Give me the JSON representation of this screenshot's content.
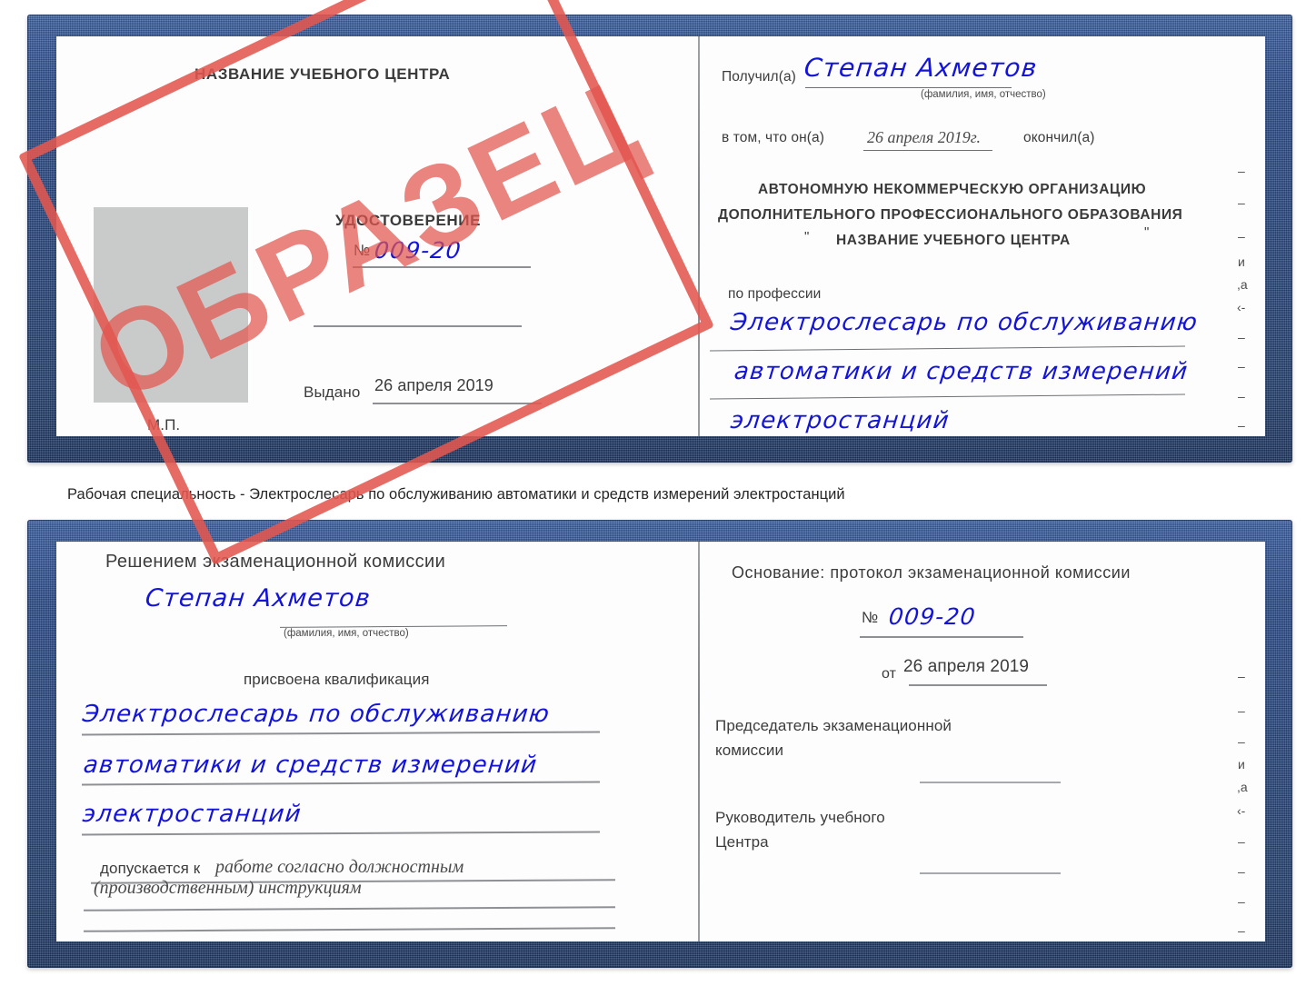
{
  "document": {
    "type": "certificate-scan",
    "stamp_label": "ОБРАЗЕЦ",
    "colors": {
      "cover_blue": "#2b4c8c",
      "stamp_red": "#e2564f",
      "handwriting_blue": "#1414d8",
      "photo_placeholder_gray": "#c9cbcb",
      "rule_gray": "#8e9094",
      "text_dark": "#3a3a3a"
    }
  },
  "caption": {
    "text": "Рабочая специальность - Электрослесарь по обслуживанию автоматики и средств измерений электростанций"
  },
  "certificate_top": {
    "left_page": {
      "center_name": "НАЗВАНИЕ УЧЕБНОГО ЦЕНТРА",
      "doc_title": "УДОСТОВЕРЕНИЕ",
      "number_label": "№",
      "number_value": "009-20",
      "issued_label": "Выдано",
      "issued_value": "26 апреля 2019",
      "seal_label": "М.П.",
      "photo_placeholder": ""
    },
    "right_page": {
      "received_label": "Получил(а)",
      "received_value": "Степан Ахметов",
      "fio_hint": "(фамилия, имя, отчество)",
      "in_that_label": "в том, что он(а)",
      "completion_date": "26 апреля 2019г.",
      "finished_label": "окончил(а)",
      "org_line1": "АВТОНОМНУЮ НЕКОММЕРЧЕСКУЮ ОРГАНИЗАЦИЮ",
      "org_line2": "ДОПОЛНИТЕЛЬНОГО ПРОФЕССИОНАЛЬНОГО ОБРАЗОВАНИЯ",
      "org_quote_open": "\"",
      "org_line3": "НАЗВАНИЕ УЧЕБНОГО ЦЕНТРА",
      "org_quote_close": "\"",
      "profession_label": "по профессии",
      "profession_line1": "Электрослесарь по обслуживанию",
      "profession_line2": "автоматики и средств измерений",
      "profession_line3": "электростанций",
      "edge_marks": [
        "–",
        "–",
        "–",
        "и",
        "а",
        "‹-",
        "–",
        "–",
        "–",
        "–"
      ]
    }
  },
  "certificate_bottom": {
    "left_page": {
      "heading": "Решением экзаменационной комиссии",
      "name_value": "Степан Ахметов",
      "fio_hint": "(фамилия, имя, отчество)",
      "qualification_label": "присвоена квалификация",
      "qualification_line1": "Электрослесарь по обслуживанию",
      "qualification_line2": "автоматики и средств измерений",
      "qualification_line3": "электростанций",
      "allowed_label": "допускается к",
      "allowed_value_line1": "работе согласно должностным",
      "allowed_value_line2": "(производственным) инструкциям"
    },
    "right_page": {
      "basis_label": "Основание: протокол экзаменационной комиссии",
      "number_label": "№",
      "number_value": "009-20",
      "date_label": "от",
      "date_value": "26 апреля 2019",
      "chairman_line1": "Председатель экзаменационной",
      "chairman_line2": "комиссии",
      "head_line1": "Руководитель учебного",
      "head_line2": "Центра",
      "edge_marks": [
        "–",
        "–",
        "–",
        "и",
        "а",
        "‹-",
        "–",
        "–",
        "–",
        "–"
      ]
    }
  }
}
